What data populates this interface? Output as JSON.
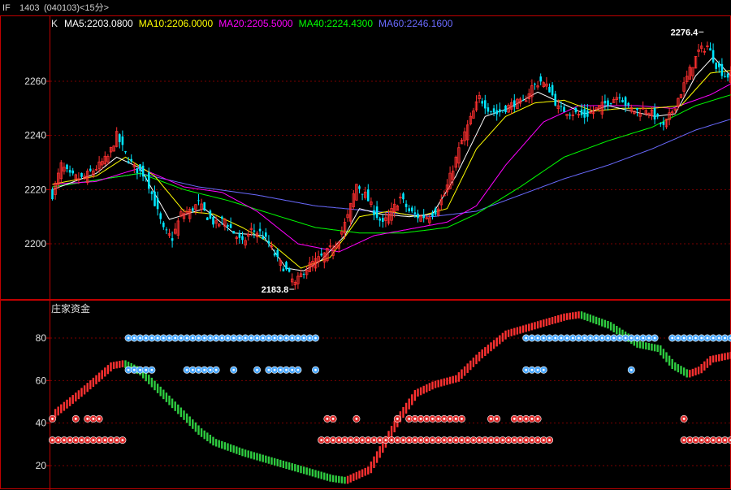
{
  "header": {
    "symbol": "IF",
    "contract": "1403",
    "code": "(040103)",
    "period": "<15分>"
  },
  "colors": {
    "background": "#000000",
    "frame": "#c00000",
    "up": "#ff3030",
    "down": "#00e5ff",
    "ma5": "#ffffff",
    "ma10": "#ffff00",
    "ma20": "#ff00ff",
    "ma40": "#00ff00",
    "ma60": "#6a6aff",
    "ind_up": "#ff3030",
    "ind_down": "#2ecc40",
    "marker_red": "#e03030",
    "marker_blue": "#4aa8ff"
  },
  "chart_data": [
    {
      "type": "candlestick",
      "title": "K",
      "legend": [
        {
          "label": "MA5:2203.0800",
          "color_key": "ma5"
        },
        {
          "label": "MA10:2206.0000",
          "color_key": "ma10"
        },
        {
          "label": "MA20:2205.5000",
          "color_key": "ma20"
        },
        {
          "label": "MA40:2224.4300",
          "color_key": "ma40"
        },
        {
          "label": "MA60:2246.1600",
          "color_key": "ma60"
        }
      ],
      "y_ticks": [
        2200,
        2220,
        2240,
        2260
      ],
      "ylim": [
        2182,
        2278
      ],
      "grid": true,
      "annotations": [
        {
          "label": "2276.4",
          "value": 2276.4,
          "index": 223
        },
        {
          "label": "2183.8",
          "value": 2183.8,
          "index": 83
        }
      ],
      "ohlc_anchors": [
        [
          0,
          2218
        ],
        [
          3,
          2229
        ],
        [
          6,
          2225
        ],
        [
          10,
          2224
        ],
        [
          15,
          2228
        ],
        [
          19,
          2232
        ],
        [
          22,
          2240
        ],
        [
          25,
          2233
        ],
        [
          28,
          2228
        ],
        [
          32,
          2225
        ],
        [
          35,
          2215
        ],
        [
          38,
          2205
        ],
        [
          41,
          2202
        ],
        [
          44,
          2211
        ],
        [
          47,
          2212
        ],
        [
          50,
          2215
        ],
        [
          53,
          2210
        ],
        [
          56,
          2207
        ],
        [
          59,
          2209
        ],
        [
          62,
          2204
        ],
        [
          65,
          2200
        ],
        [
          68,
          2205
        ],
        [
          71,
          2204
        ],
        [
          74,
          2200
        ],
        [
          77,
          2194
        ],
        [
          80,
          2190
        ],
        [
          83,
          2185
        ],
        [
          86,
          2190
        ],
        [
          89,
          2193
        ],
        [
          92,
          2195
        ],
        [
          95,
          2198
        ],
        [
          98,
          2202
        ],
        [
          101,
          2210
        ],
        [
          104,
          2222
        ],
        [
          107,
          2218
        ],
        [
          110,
          2212
        ],
        [
          113,
          2207
        ],
        [
          116,
          2212
        ],
        [
          119,
          2217
        ],
        [
          122,
          2212
        ],
        [
          125,
          2210
        ],
        [
          128,
          2210
        ],
        [
          131,
          2212
        ],
        [
          134,
          2218
        ],
        [
          137,
          2228
        ],
        [
          140,
          2238
        ],
        [
          143,
          2246
        ],
        [
          146,
          2254
        ],
        [
          149,
          2250
        ],
        [
          152,
          2248
        ],
        [
          155,
          2250
        ],
        [
          158,
          2252
        ],
        [
          161,
          2252
        ],
        [
          164,
          2258
        ],
        [
          167,
          2260
        ],
        [
          170,
          2257
        ],
        [
          173,
          2250
        ],
        [
          176,
          2249
        ],
        [
          179,
          2248
        ],
        [
          182,
          2247
        ],
        [
          185,
          2249
        ],
        [
          188,
          2251
        ],
        [
          191,
          2253
        ],
        [
          194,
          2255
        ],
        [
          197,
          2250
        ],
        [
          200,
          2249
        ],
        [
          203,
          2250
        ],
        [
          206,
          2247
        ],
        [
          209,
          2243
        ],
        [
          212,
          2249
        ],
        [
          215,
          2256
        ],
        [
          218,
          2264
        ],
        [
          221,
          2271
        ],
        [
          224,
          2273
        ],
        [
          227,
          2266
        ],
        [
          230,
          2262
        ],
        [
          232,
          2262
        ]
      ],
      "ma_anchors": {
        "ma5": [
          [
            0,
            2220
          ],
          [
            15,
            2226
          ],
          [
            22,
            2232
          ],
          [
            30,
            2228
          ],
          [
            40,
            2209
          ],
          [
            52,
            2213
          ],
          [
            62,
            2204
          ],
          [
            72,
            2203
          ],
          [
            80,
            2191
          ],
          [
            86,
            2190
          ],
          [
            92,
            2194
          ],
          [
            100,
            2203
          ],
          [
            105,
            2213
          ],
          [
            112,
            2211
          ],
          [
            122,
            2210
          ],
          [
            130,
            2211
          ],
          [
            138,
            2225
          ],
          [
            148,
            2247
          ],
          [
            156,
            2250
          ],
          [
            166,
            2256
          ],
          [
            174,
            2252
          ],
          [
            182,
            2248
          ],
          [
            190,
            2251
          ],
          [
            198,
            2249
          ],
          [
            206,
            2247
          ],
          [
            213,
            2248
          ],
          [
            220,
            2262
          ],
          [
            226,
            2269
          ],
          [
            232,
            2262
          ]
        ],
        "ma10": [
          [
            0,
            2222
          ],
          [
            15,
            2225
          ],
          [
            25,
            2232
          ],
          [
            35,
            2225
          ],
          [
            45,
            2212
          ],
          [
            55,
            2211
          ],
          [
            65,
            2206
          ],
          [
            75,
            2200
          ],
          [
            85,
            2191
          ],
          [
            95,
            2195
          ],
          [
            105,
            2210
          ],
          [
            115,
            2212
          ],
          [
            125,
            2210
          ],
          [
            135,
            2213
          ],
          [
            145,
            2235
          ],
          [
            155,
            2247
          ],
          [
            165,
            2252
          ],
          [
            175,
            2253
          ],
          [
            185,
            2249
          ],
          [
            195,
            2250
          ],
          [
            205,
            2250
          ],
          [
            215,
            2251
          ],
          [
            225,
            2263
          ],
          [
            232,
            2264
          ]
        ],
        "ma20": [
          [
            0,
            2222
          ],
          [
            15,
            2223
          ],
          [
            30,
            2228
          ],
          [
            45,
            2221
          ],
          [
            58,
            2219
          ],
          [
            70,
            2212
          ],
          [
            84,
            2200
          ],
          [
            98,
            2197
          ],
          [
            110,
            2203
          ],
          [
            125,
            2206
          ],
          [
            135,
            2208
          ],
          [
            145,
            2214
          ],
          [
            155,
            2229
          ],
          [
            168,
            2245
          ],
          [
            180,
            2251
          ],
          [
            190,
            2251
          ],
          [
            200,
            2251
          ],
          [
            212,
            2250
          ],
          [
            225,
            2255
          ],
          [
            232,
            2259
          ]
        ],
        "ma40": [
          [
            0,
            2221
          ],
          [
            18,
            2224
          ],
          [
            30,
            2226
          ],
          [
            45,
            2220
          ],
          [
            60,
            2216
          ],
          [
            75,
            2211
          ],
          [
            90,
            2206
          ],
          [
            105,
            2204
          ],
          [
            120,
            2204
          ],
          [
            135,
            2206
          ],
          [
            145,
            2211
          ],
          [
            160,
            2221
          ],
          [
            175,
            2232
          ],
          [
            190,
            2238
          ],
          [
            205,
            2243
          ],
          [
            220,
            2251
          ],
          [
            232,
            2255
          ]
        ],
        "ma60": [
          [
            0,
            2221
          ],
          [
            30,
            2226
          ],
          [
            50,
            2221
          ],
          [
            70,
            2218
          ],
          [
            90,
            2214
          ],
          [
            110,
            2212
          ],
          [
            130,
            2210
          ],
          [
            145,
            2212
          ],
          [
            160,
            2218
          ],
          [
            175,
            2224
          ],
          [
            190,
            2229
          ],
          [
            205,
            2235
          ],
          [
            220,
            2242
          ],
          [
            232,
            2246
          ]
        ]
      }
    },
    {
      "type": "bar",
      "title": "庄家资金",
      "y_ticks": [
        20,
        40,
        60,
        80
      ],
      "ylim": [
        10,
        98
      ],
      "grid": true,
      "value_anchors": [
        [
          0,
          44
        ],
        [
          10,
          55
        ],
        [
          20,
          67
        ],
        [
          24,
          68
        ],
        [
          30,
          64
        ],
        [
          40,
          50
        ],
        [
          50,
          36
        ],
        [
          55,
          31
        ],
        [
          65,
          26
        ],
        [
          80,
          20
        ],
        [
          95,
          14
        ],
        [
          100,
          13
        ],
        [
          108,
          18
        ],
        [
          113,
          30
        ],
        [
          118,
          42
        ],
        [
          124,
          54
        ],
        [
          130,
          58
        ],
        [
          138,
          61
        ],
        [
          146,
          72
        ],
        [
          155,
          82
        ],
        [
          165,
          86
        ],
        [
          175,
          90
        ],
        [
          180,
          91
        ],
        [
          190,
          86
        ],
        [
          200,
          77
        ],
        [
          207,
          75
        ],
        [
          212,
          67
        ],
        [
          217,
          63
        ],
        [
          221,
          65
        ],
        [
          225,
          70
        ],
        [
          232,
          72
        ]
      ],
      "marker_rows": [
        {
          "value": 80,
          "color_key": "marker_blue",
          "spans": [
            [
              25,
              90
            ],
            [
              162,
              206
            ],
            [
              212,
              233
            ]
          ]
        },
        {
          "value": 65,
          "color_key": "marker_blue",
          "spans": [
            [
              25,
              34
            ],
            [
              41,
              41
            ],
            [
              46,
              57
            ],
            [
              62,
              63
            ],
            [
              70,
              70
            ],
            [
              73,
              84
            ],
            [
              90,
              91
            ],
            [
              162,
              168
            ],
            [
              173,
              173
            ],
            [
              198,
              199
            ],
            [
              205,
              205
            ],
            [
              217,
              217
            ]
          ]
        },
        {
          "value": 42,
          "color_key": "marker_red",
          "spans": [
            [
              0,
              1
            ],
            [
              8,
              8
            ],
            [
              12,
              16
            ],
            [
              25,
              25
            ],
            [
              93,
              97
            ],
            [
              101,
              101
            ],
            [
              103,
              105
            ],
            [
              111,
              111
            ],
            [
              118,
              118
            ],
            [
              122,
              141
            ],
            [
              145,
              145
            ],
            [
              149,
              153
            ],
            [
              158,
              166
            ],
            [
              216,
              217
            ],
            [
              225,
              225
            ]
          ]
        },
        {
          "value": 32,
          "color_key": "marker_red",
          "spans": [
            [
              0,
              25
            ],
            [
              91,
              170
            ],
            [
              216,
              233
            ]
          ]
        }
      ]
    }
  ]
}
